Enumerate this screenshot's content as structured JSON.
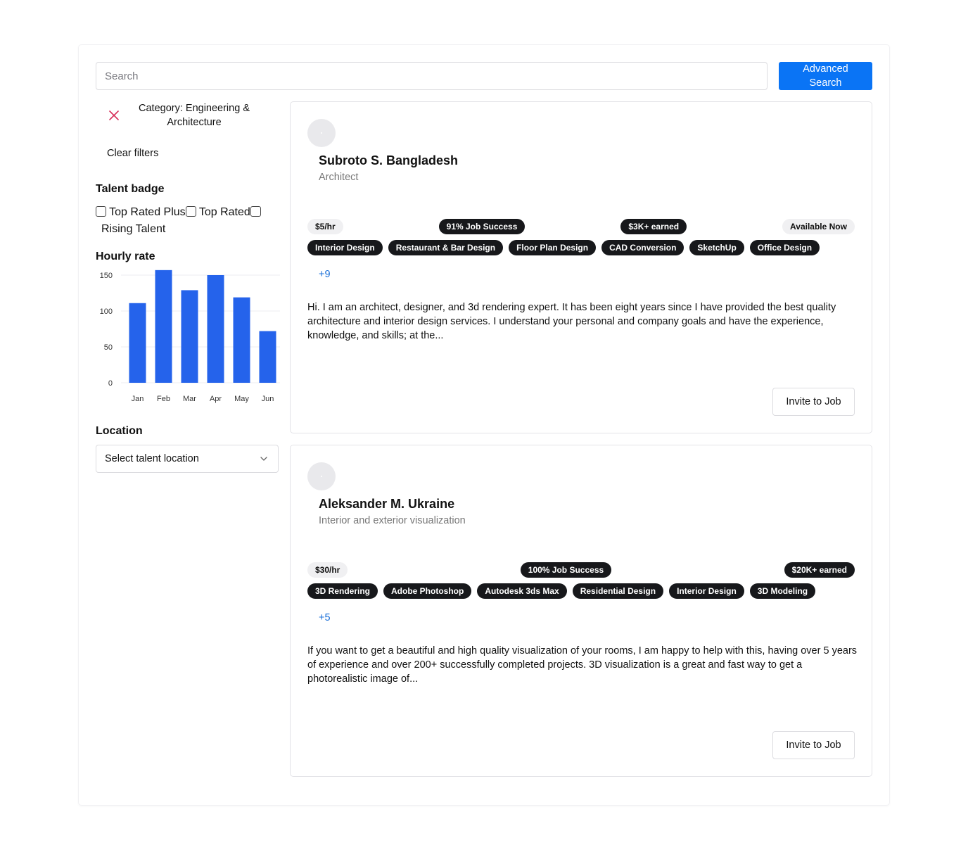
{
  "search": {
    "placeholder": "Search",
    "button_label": "Advanced Search"
  },
  "filters": {
    "active_chip": "Category: Engineering & Architecture",
    "clear_label": "Clear filters",
    "talent_badge": {
      "title": "Talent badge",
      "options": [
        "Top Rated Plus",
        "Top Rated",
        "Rising Talent"
      ]
    },
    "hourly_rate": {
      "title": "Hourly rate"
    },
    "location": {
      "title": "Location",
      "placeholder": "Select talent location"
    }
  },
  "chart_data": {
    "type": "bar",
    "categories": [
      "Jan",
      "Feb",
      "Mar",
      "Apr",
      "May",
      "Jun"
    ],
    "values": [
      111,
      157,
      129,
      150,
      119,
      72
    ],
    "ylim": [
      0,
      150
    ],
    "yticks": [
      0,
      50,
      100,
      150
    ],
    "grid": true,
    "color": "#2563eb"
  },
  "freelancers": [
    {
      "name": "Subroto S. Bangladesh",
      "title": "Architect",
      "rate": "$5/hr",
      "job_success": "91% Job Success",
      "earned": "$3K+ earned",
      "availability": "Available Now",
      "skills": [
        "Interior Design",
        "Restaurant & Bar Design",
        "Floor Plan Design",
        "CAD Conversion",
        "SketchUp",
        "Office Design"
      ],
      "more": "+9",
      "bio": "Hi. I am an architect, designer, and 3d rendering expert. It has been eight years since I have provided the best quality architecture and interior design services. I understand your personal and company goals and have the experience, knowledge, and skills; at the...",
      "invite_label": "Invite to Job"
    },
    {
      "name": "Aleksander M. Ukraine",
      "title": "Interior and exterior visualization",
      "rate": "$30/hr",
      "job_success": "100% Job Success",
      "earned": "$20K+ earned",
      "skills": [
        "3D Rendering",
        "Adobe Photoshop",
        "Autodesk 3ds Max",
        "Residential Design",
        "Interior Design",
        "3D Modeling"
      ],
      "more": "+5",
      "bio": "If you want to get a beautiful and high quality visualization of your rooms, I am happy to help with this, having over 5 years of experience and over 200+ successfully completed projects. 3D visualization is a great and fast way to get a photorealistic image of...",
      "invite_label": "Invite to Job"
    }
  ],
  "colors": {
    "accent": "#0a74f5",
    "danger": "#d6305a",
    "link": "#1a6fd8",
    "bar": "#2563eb"
  },
  "icons": {
    "remove_filter": "close-icon",
    "dropdown": "chevron-down-icon"
  }
}
